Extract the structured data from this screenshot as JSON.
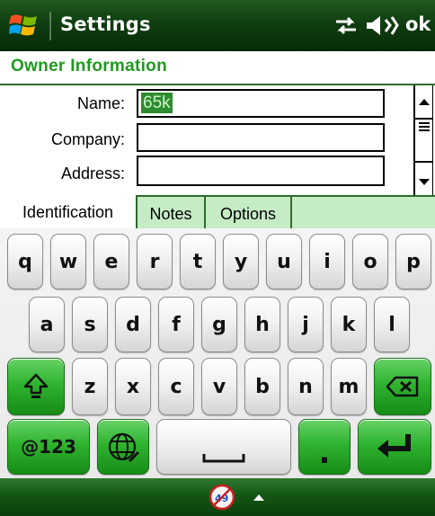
{
  "titlebar": {
    "title": "Settings",
    "ok_label": "ok",
    "icons": [
      "windows-start-icon",
      "connectivity-icon",
      "volume-icon"
    ]
  },
  "section": {
    "title": "Owner Information"
  },
  "form": {
    "fields": [
      {
        "label": "Name:",
        "value": "65k"
      },
      {
        "label": "Company:",
        "value": ""
      },
      {
        "label": "Address:",
        "value": ""
      }
    ]
  },
  "tabs": [
    {
      "label": "Identification",
      "active": true
    },
    {
      "label": "Notes",
      "active": false
    },
    {
      "label": "Options",
      "active": false
    }
  ],
  "keyboard": {
    "row1": [
      "q",
      "w",
      "e",
      "r",
      "t",
      "y",
      "u",
      "i",
      "o",
      "p"
    ],
    "row2": [
      "a",
      "s",
      "d",
      "f",
      "g",
      "h",
      "j",
      "k",
      "l"
    ],
    "row3": [
      "z",
      "x",
      "c",
      "v",
      "b",
      "n",
      "m"
    ],
    "symbols_label": "@123",
    "period_label": ".",
    "icons": [
      "shift-icon",
      "backspace-icon",
      "globe-icon",
      "space-icon",
      "enter-icon"
    ]
  },
  "bottombar": {
    "icons": [
      "input-panel-icon",
      "chevron-up-icon"
    ]
  },
  "colors": {
    "accent_green": "#1f9a1f",
    "bar_green": "#0f3d10",
    "selection": "#2d8c2d"
  }
}
